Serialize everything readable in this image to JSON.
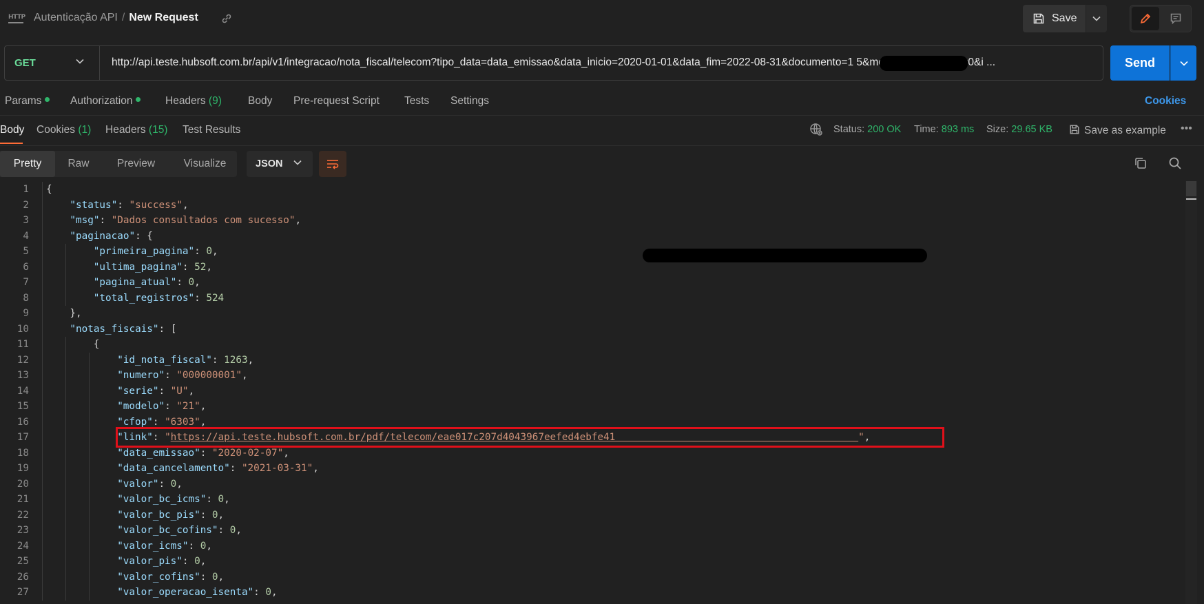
{
  "breadcrumb": {
    "collection": "Autenticação API",
    "separator": "/",
    "request": "New Request"
  },
  "toolbar": {
    "save_label": "Save"
  },
  "request": {
    "method": "GET",
    "url": "http://api.teste.hubsoft.com.br/api/v1/integracao/nota_fiscal/telecom?tipo_data=data_emissao&data_inicio=2020-01-01&data_fim=2022-08-31&documento=1                5&modelo=21&pagina=0&i ..."
  },
  "send": {
    "label": "Send"
  },
  "request_tabs": {
    "params": "Params",
    "authorization": "Authorization",
    "headers": "Headers",
    "headers_count": "(9)",
    "body": "Body",
    "pre_request": "Pre-request Script",
    "tests": "Tests",
    "settings": "Settings",
    "cookies": "Cookies"
  },
  "response_tabs": {
    "body": "Body",
    "cookies": "Cookies",
    "cookies_count": "(1)",
    "headers": "Headers",
    "headers_count": "(15)",
    "test_results": "Test Results"
  },
  "response_meta": {
    "status_label": "Status:",
    "status_value": "200 OK",
    "time_label": "Time:",
    "time_value": "893 ms",
    "size_label": "Size:",
    "size_value": "29.65 KB",
    "save_example": "Save as example"
  },
  "format": {
    "pretty": "Pretty",
    "raw": "Raw",
    "preview": "Preview",
    "visualize": "Visualize",
    "language": "JSON"
  },
  "code_lines": [
    {
      "n": "1",
      "indent": 0,
      "parts": [
        [
          "p",
          "{"
        ]
      ]
    },
    {
      "n": "2",
      "indent": 1,
      "parts": [
        [
          "k",
          "\"status\""
        ],
        [
          "p",
          ": "
        ],
        [
          "s",
          "\"success\""
        ],
        [
          "p",
          ","
        ]
      ]
    },
    {
      "n": "3",
      "indent": 1,
      "parts": [
        [
          "k",
          "\"msg\""
        ],
        [
          "p",
          ": "
        ],
        [
          "s",
          "\"Dados consultados com sucesso\""
        ],
        [
          "p",
          ","
        ]
      ]
    },
    {
      "n": "4",
      "indent": 1,
      "parts": [
        [
          "k",
          "\"paginacao\""
        ],
        [
          "p",
          ": {"
        ]
      ]
    },
    {
      "n": "5",
      "indent": 2,
      "parts": [
        [
          "k",
          "\"primeira_pagina\""
        ],
        [
          "p",
          ": "
        ],
        [
          "n",
          "0"
        ],
        [
          "p",
          ","
        ]
      ]
    },
    {
      "n": "6",
      "indent": 2,
      "parts": [
        [
          "k",
          "\"ultima_pagina\""
        ],
        [
          "p",
          ": "
        ],
        [
          "n",
          "52"
        ],
        [
          "p",
          ","
        ]
      ]
    },
    {
      "n": "7",
      "indent": 2,
      "parts": [
        [
          "k",
          "\"pagina_atual\""
        ],
        [
          "p",
          ": "
        ],
        [
          "n",
          "0"
        ],
        [
          "p",
          ","
        ]
      ]
    },
    {
      "n": "8",
      "indent": 2,
      "parts": [
        [
          "k",
          "\"total_registros\""
        ],
        [
          "p",
          ": "
        ],
        [
          "n",
          "524"
        ]
      ]
    },
    {
      "n": "9",
      "indent": 1,
      "parts": [
        [
          "p",
          "},"
        ]
      ]
    },
    {
      "n": "10",
      "indent": 1,
      "parts": [
        [
          "k",
          "\"notas_fiscais\""
        ],
        [
          "p",
          ": ["
        ]
      ]
    },
    {
      "n": "11",
      "indent": 2,
      "parts": [
        [
          "p",
          "{"
        ]
      ]
    },
    {
      "n": "12",
      "indent": 3,
      "parts": [
        [
          "k",
          "\"id_nota_fiscal\""
        ],
        [
          "p",
          ": "
        ],
        [
          "n",
          "1263"
        ],
        [
          "p",
          ","
        ]
      ]
    },
    {
      "n": "13",
      "indent": 3,
      "parts": [
        [
          "k",
          "\"numero\""
        ],
        [
          "p",
          ": "
        ],
        [
          "s",
          "\"000000001\""
        ],
        [
          "p",
          ","
        ]
      ]
    },
    {
      "n": "14",
      "indent": 3,
      "parts": [
        [
          "k",
          "\"serie\""
        ],
        [
          "p",
          ": "
        ],
        [
          "s",
          "\"U\""
        ],
        [
          "p",
          ","
        ]
      ]
    },
    {
      "n": "15",
      "indent": 3,
      "parts": [
        [
          "k",
          "\"modelo\""
        ],
        [
          "p",
          ": "
        ],
        [
          "s",
          "\"21\""
        ],
        [
          "p",
          ","
        ]
      ]
    },
    {
      "n": "16",
      "indent": 3,
      "parts": [
        [
          "k",
          "\"cfop\""
        ],
        [
          "p",
          ": "
        ],
        [
          "s",
          "\"6303\""
        ],
        [
          "p",
          ","
        ]
      ]
    },
    {
      "n": "17",
      "indent": 3,
      "parts": [
        [
          "k",
          "\"link\""
        ],
        [
          "p",
          ": "
        ],
        [
          "s",
          "\""
        ],
        [
          "u",
          "https://api.teste.hubsoft.com.br/pdf/telecom/eae017c207d4043967eefed4ebfe41                                         "
        ],
        [
          "s",
          "\""
        ],
        [
          "p",
          ","
        ]
      ]
    },
    {
      "n": "18",
      "indent": 3,
      "parts": [
        [
          "k",
          "\"data_emissao\""
        ],
        [
          "p",
          ": "
        ],
        [
          "s",
          "\"2020-02-07\""
        ],
        [
          "p",
          ","
        ]
      ]
    },
    {
      "n": "19",
      "indent": 3,
      "parts": [
        [
          "k",
          "\"data_cancelamento\""
        ],
        [
          "p",
          ": "
        ],
        [
          "s",
          "\"2021-03-31\""
        ],
        [
          "p",
          ","
        ]
      ]
    },
    {
      "n": "20",
      "indent": 3,
      "parts": [
        [
          "k",
          "\"valor\""
        ],
        [
          "p",
          ": "
        ],
        [
          "n",
          "0"
        ],
        [
          "p",
          ","
        ]
      ]
    },
    {
      "n": "21",
      "indent": 3,
      "parts": [
        [
          "k",
          "\"valor_bc_icms\""
        ],
        [
          "p",
          ": "
        ],
        [
          "n",
          "0"
        ],
        [
          "p",
          ","
        ]
      ]
    },
    {
      "n": "22",
      "indent": 3,
      "parts": [
        [
          "k",
          "\"valor_bc_pis\""
        ],
        [
          "p",
          ": "
        ],
        [
          "n",
          "0"
        ],
        [
          "p",
          ","
        ]
      ]
    },
    {
      "n": "23",
      "indent": 3,
      "parts": [
        [
          "k",
          "\"valor_bc_cofins\""
        ],
        [
          "p",
          ": "
        ],
        [
          "n",
          "0"
        ],
        [
          "p",
          ","
        ]
      ]
    },
    {
      "n": "24",
      "indent": 3,
      "parts": [
        [
          "k",
          "\"valor_icms\""
        ],
        [
          "p",
          ": "
        ],
        [
          "n",
          "0"
        ],
        [
          "p",
          ","
        ]
      ]
    },
    {
      "n": "25",
      "indent": 3,
      "parts": [
        [
          "k",
          "\"valor_pis\""
        ],
        [
          "p",
          ": "
        ],
        [
          "n",
          "0"
        ],
        [
          "p",
          ","
        ]
      ]
    },
    {
      "n": "26",
      "indent": 3,
      "parts": [
        [
          "k",
          "\"valor_cofins\""
        ],
        [
          "p",
          ": "
        ],
        [
          "n",
          "0"
        ],
        [
          "p",
          ","
        ]
      ]
    },
    {
      "n": "27",
      "indent": 3,
      "parts": [
        [
          "k",
          "\"valor_operacao_isenta\""
        ],
        [
          "p",
          ": "
        ],
        [
          "n",
          "0"
        ],
        [
          "p",
          ","
        ]
      ]
    }
  ],
  "colors": {
    "accent": "#ff6c37",
    "send": "#0e73d8",
    "success": "#2fb56a",
    "highlight": "#e0101a"
  }
}
